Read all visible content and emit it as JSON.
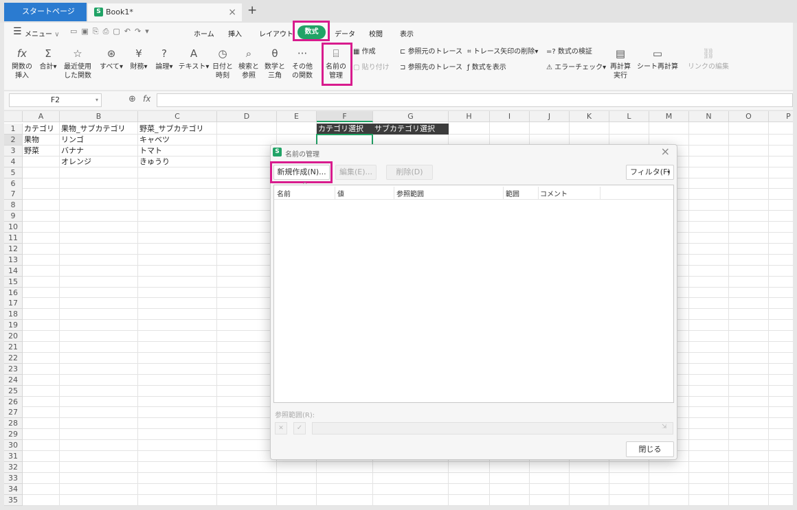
{
  "tabs": {
    "start": "スタートページ",
    "book": "Book1*",
    "new": "+",
    "close": "×",
    "book_icon": "S"
  },
  "menu": {
    "label": "メニュー",
    "chevron": "∨",
    "items": [
      "ホーム",
      "挿入",
      "レイアウト",
      "数式",
      "データ",
      "校閲",
      "表示"
    ],
    "active": "数式"
  },
  "ribbon": {
    "insert_fn": "関数の\n挿入",
    "sum": "合計",
    "recent": "最近使用\nした関数",
    "all": "すべて",
    "financial": "財務",
    "logical": "論理",
    "text": "テキスト",
    "datetime": "日付と\n時刻",
    "lookup": "検索と\n参照",
    "math": "数学と\n三角",
    "other": "その他\nの関数",
    "name_mgr": "名前の\n管理",
    "create": "作成",
    "paste": "貼り付け",
    "trace_prec": "参照元のトレース",
    "trace_dep": "参照先のトレース",
    "remove_arrows": "トレース矢印の削除",
    "show_formulas": "数式を表示",
    "check": "数式の検証",
    "error_check": "エラーチェック",
    "recalc": "再計算\n実行",
    "sheet_recalc": "シート再計算",
    "edit_links": "リンクの編集"
  },
  "formula_bar": {
    "name_box": "F2",
    "fx": "fx"
  },
  "columns": [
    "A",
    "B",
    "C",
    "D",
    "E",
    "F",
    "G",
    "H",
    "I",
    "J",
    "K",
    "L",
    "M",
    "N",
    "O",
    "P"
  ],
  "rows": [
    "1",
    "2",
    "3",
    "4",
    "5",
    "6",
    "7",
    "8",
    "9",
    "10",
    "11",
    "12",
    "13",
    "14",
    "15",
    "16",
    "17",
    "18",
    "19",
    "20",
    "21",
    "22",
    "23",
    "24",
    "25",
    "26",
    "27",
    "28",
    "29",
    "30",
    "31",
    "32",
    "33",
    "34",
    "35"
  ],
  "cells": {
    "A1": "カテゴリ",
    "B1": "果物_サブカテゴリ",
    "C1": "野菜_サブカテゴリ",
    "A2": "果物",
    "B2": "リンゴ",
    "C2": "キャベツ",
    "A3": "野菜",
    "B3": "バナナ",
    "C3": "トマト",
    "B4": "オレンジ",
    "C4": "きゅうり",
    "F1": "カテゴリ選択",
    "G1": "サブカテゴリ選択"
  },
  "dialog": {
    "title": "名前の管理",
    "new": "新規作成(N)...",
    "edit": "編集(E)...",
    "delete": "削除(D)",
    "filter": "フィルタ(F)",
    "columns": [
      "名前",
      "値",
      "参照範囲",
      "範囲",
      "コメント"
    ],
    "ref_label": "参照範囲(R):",
    "close": "閉じる",
    "x": "×",
    "cancel": "✕",
    "ok": "✓"
  },
  "colors": {
    "accent_green": "#21a366",
    "highlight": "#d81b8d",
    "tab_blue": "#2b7bd0"
  }
}
